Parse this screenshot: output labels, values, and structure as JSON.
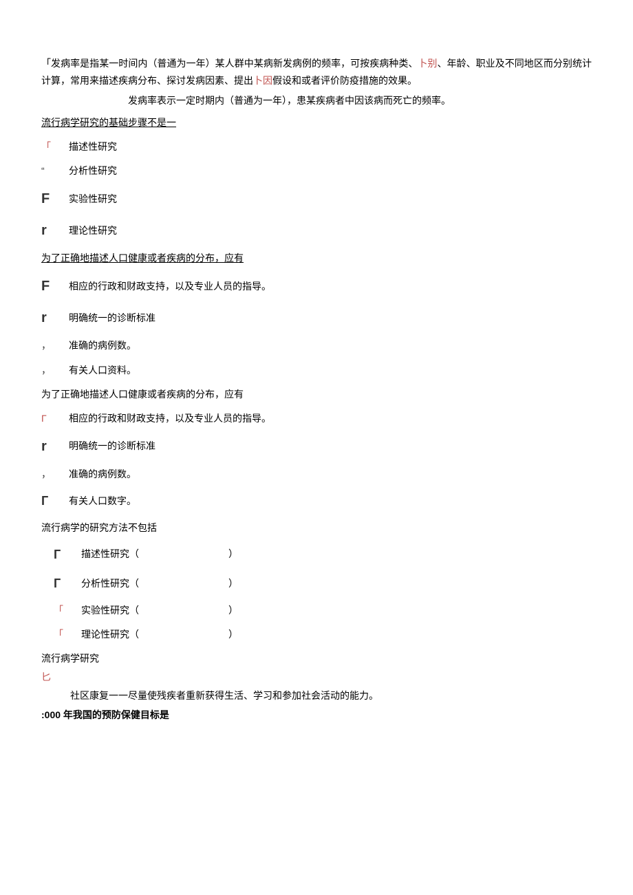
{
  "intro": {
    "p1_a": "「发病率是指某一时间内（普通为一年）某人群中某病新发病例的频率，可按疾病种类、",
    "p1_b": "卜别",
    "p1_c": "、年龄、职业及不同地区而分别统计计算，常用来描述疾病分布、探讨发病因素、提出",
    "p1_d": "卜因",
    "p1_e": "假设和或者评价防疫措施的效果。",
    "p2": "发病率表示一定时期内（普通为一年），患某疾病者中因该病而死亡的频率。"
  },
  "q1": {
    "stem": "流行病学研究的基础步骤不是一",
    "opts": [
      {
        "m": "「",
        "mc": "marker-red",
        "t": "描述性研究"
      },
      {
        "m": "“",
        "mc": "marker-dark",
        "t": "分析性研究"
      },
      {
        "m": "F",
        "mc": "marker-bigF",
        "t": "实验性研究"
      },
      {
        "m": "r",
        "mc": "marker-bigR",
        "t": "理论性研究"
      }
    ]
  },
  "q2": {
    "stem": "为了正确地描述人口健康或者疾病的分布，应有",
    "opts": [
      {
        "m": "F",
        "mc": "marker-bigF",
        "t": "相应的行政和财政支持，以及专业人员的指导。"
      },
      {
        "m": "r",
        "mc": "marker-bigR",
        "t": "明确统一的诊断标准"
      },
      {
        "m": "，",
        "mc": "marker-dark",
        "t": "准确的病例数。"
      },
      {
        "m": "，",
        "mc": "marker-dark",
        "t": "有关人口资料。"
      }
    ]
  },
  "q3": {
    "stem": "为了正确地描述人口健康或者疾病的分布，应有",
    "opts": [
      {
        "m": "Г",
        "mc": "marker-red",
        "t": "相应的行政和财政支持，以及专业人员的指导。"
      },
      {
        "m": "r",
        "mc": "marker-bigR",
        "t": "明确统一的诊断标准"
      },
      {
        "m": "，",
        "mc": "marker-dark",
        "t": "准确的病例数。"
      },
      {
        "m": "Г",
        "mc": "marker-boxG",
        "t": "有关人口数字。"
      }
    ]
  },
  "q4": {
    "stem": "流行病学的研究方法不包括",
    "opts": [
      {
        "m": "Г",
        "mc": "marker-boxG",
        "t": "描述性研究（",
        "tail": "）"
      },
      {
        "m": "Г",
        "mc": "marker-boxG",
        "t": "分析性研究（",
        "tail": "）"
      },
      {
        "m": "「",
        "mc": "marker-red",
        "t": "实验性研究（",
        "tail": "）"
      },
      {
        "m": "「",
        "mc": "marker-red",
        "t": "理论性研究（",
        "tail": "）"
      }
    ]
  },
  "tail": {
    "p1": "流行病学研究",
    "p2": "匕",
    "p3": "社区康复一一尽量使残疾者重新获得生活、学习和参加社会活动的能力。",
    "p4": ":000 年我国的预防保健目标是"
  }
}
